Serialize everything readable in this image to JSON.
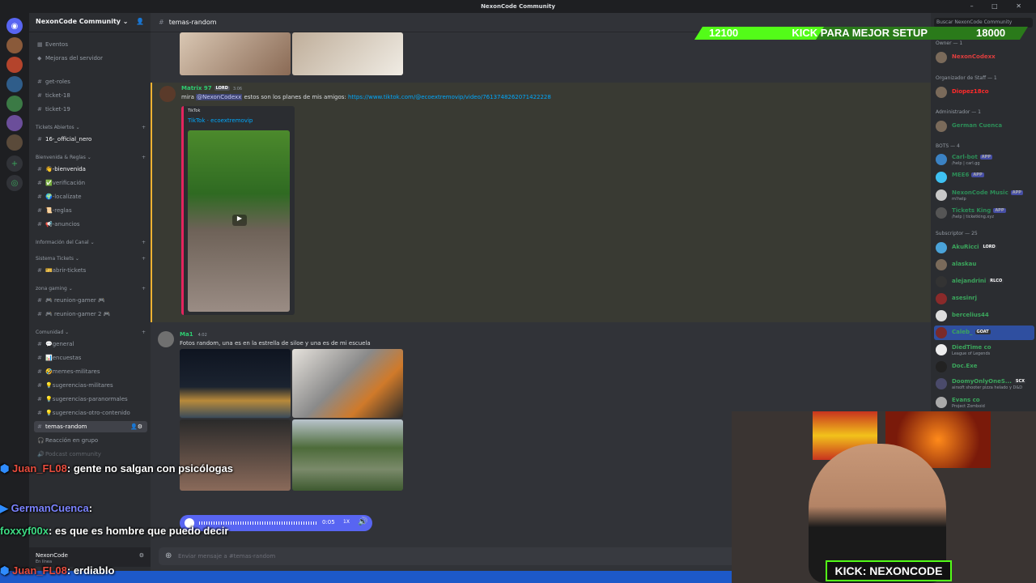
{
  "window": {
    "title": "NexonCode Community",
    "controls": "– □ ✕"
  },
  "server": {
    "name": "NexonCode Community ⌄",
    "top_items": [
      "Eventos",
      "Mejoras del servidor"
    ],
    "channels_top": [
      "get-roles",
      "ticket-18",
      "ticket-19"
    ],
    "categories": [
      {
        "name": "Tickets Abiertos ⌄",
        "channels": [
          "16-_official_nero"
        ]
      },
      {
        "name": "Bienvenida & Reglas ⌄",
        "channels": [
          "👋-bienvenida",
          "✅verificación",
          "🌍-localízate",
          "📜-reglas",
          "📢-anuncios"
        ]
      },
      {
        "name": "Información del Canal ⌄",
        "channels": []
      },
      {
        "name": "Sistema Tickets ⌄",
        "channels": [
          "🎫abrir-tickets"
        ]
      },
      {
        "name": "zona gaming ⌄",
        "channels": [
          "🎮 reunion-gamer 🎮",
          "🎮 reunion-gamer 2 🎮"
        ]
      },
      {
        "name": "Comunidad ⌄",
        "channels": [
          "💬general",
          "📊encuestas",
          "🤣memes-militares",
          "💡sugerencias-militares",
          "💡sugerencias-paranormales",
          "💡sugerencias-otro-contenido",
          "temas-random",
          "Reacción en grupo",
          "Podcast community"
        ]
      }
    ]
  },
  "channel_header": {
    "name": "temas-random"
  },
  "messages": [
    {
      "author": "Matrix 97",
      "badge": "LORD",
      "time": "3:06",
      "text_prefix": "mira ",
      "mention": "@NexonCodexx",
      "text_mid": " estos son los planes de mis amigos: ",
      "link": "https://www.tiktok.com/@ecoextremovip/video/7613748262071422228",
      "embed": {
        "provider": "TikTok",
        "title": "TikTok · ecoextremovip"
      }
    },
    {
      "author": "Ma1",
      "time": "4:02",
      "text": "Fotos random, una es en la estrella de siloe y una es de mi escuela"
    }
  ],
  "input": {
    "placeholder": "Enviar mensaje a #temas-random"
  },
  "audio": {
    "time": "0:05",
    "speed": "1X"
  },
  "members": {
    "search_placeholder": "Buscar NexonCode Community",
    "groups": [
      {
        "header": "Owner — 1",
        "items": [
          {
            "name": "NexonCodexx",
            "color": "#e03e3e"
          }
        ]
      },
      {
        "header": "Organizador de Staff — 1",
        "items": [
          {
            "name": "Diopez18co",
            "color": "#ff2a2a"
          }
        ]
      },
      {
        "header": "Administrador — 1",
        "items": [
          {
            "name": "German Cuenca",
            "color": "#2ecc71"
          }
        ]
      },
      {
        "header": "BOTS — 4",
        "items": [
          {
            "name": "Carl-bot",
            "color": "#2ecc71",
            "tag": "APP",
            "sub": "/help | carl.gg"
          },
          {
            "name": "MEE6",
            "color": "#2ecc71",
            "tag": "APP",
            "sub": ""
          },
          {
            "name": "NexonCode Music",
            "color": "#2ecc71",
            "tag": "APP",
            "sub": "m!help"
          },
          {
            "name": "Tickets King",
            "color": "#2ecc71",
            "tag": "APP",
            "sub": "/help | ticketking.xyz"
          }
        ]
      },
      {
        "header": "Subscriptor — 25",
        "items": [
          {
            "name": "AkuRicci",
            "color": "#3ba55c",
            "tag": "LORD",
            "sub": ""
          },
          {
            "name": "alaskau",
            "color": "#3ba55c",
            "sub": ""
          },
          {
            "name": "alejandrini",
            "color": "#3ba55c",
            "tag": "RLCO",
            "sub": ""
          },
          {
            "name": "asesinrj",
            "color": "#3ba55c",
            "sub": ""
          },
          {
            "name": "bercelius44",
            "color": "#3ba55c",
            "sub": ""
          },
          {
            "name": "Caleb_",
            "color": "#3ba55c",
            "tag": "GOAT",
            "sub": ""
          },
          {
            "name": "DiedTime co",
            "color": "#3ba55c",
            "sub": "League of Legends"
          },
          {
            "name": "Doc.Exe",
            "color": "#3ba55c",
            "sub": ""
          },
          {
            "name": "DoomyOnlyOneS...",
            "color": "#3ba55c",
            "tag": "SCX",
            "sub": "airsoft shooter pizza helado y D&D"
          },
          {
            "name": "Evans co",
            "color": "#3ba55c",
            "sub": "Project Zomboid"
          }
        ]
      }
    ]
  },
  "stream": {
    "goal_left": "12100",
    "goal_text": "KICK PARA MEJOR SETUP",
    "goal_right": "18000",
    "kick_brand": "KICK: NEXONCODE",
    "chat": [
      {
        "user": "Juan_FL08",
        "text": ": gente no salgan con psicólogas",
        "color": "#e84c3d"
      },
      {
        "user": "GermanCuenca",
        "text": ":",
        "color": "#7b83ff"
      },
      {
        "user": "foxxyf00x",
        "text": ": es que es hombre que puedo decir",
        "color": "#3ddc84"
      },
      {
        "user": "Juan_FL08",
        "text": ": erdiablo",
        "color": "#e84c3d"
      }
    ]
  },
  "user_panel": {
    "name": "NexonCode",
    "status": "En línea"
  },
  "colors": {
    "accent": "#5865f2",
    "kick_green": "#53fc18"
  }
}
